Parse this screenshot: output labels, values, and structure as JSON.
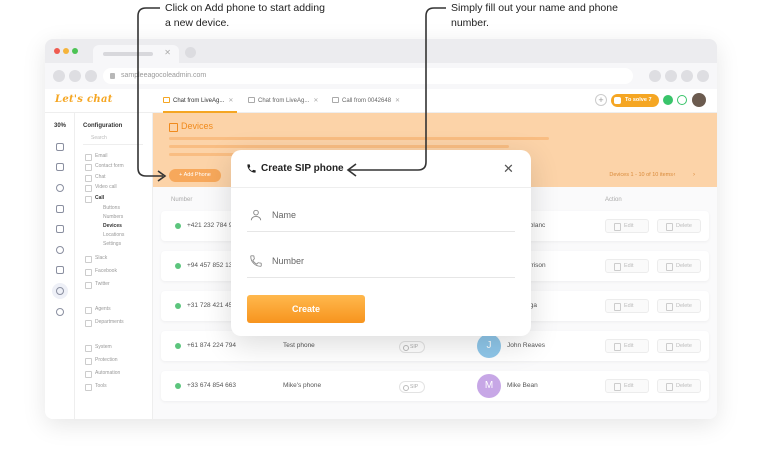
{
  "callouts": {
    "left": "Click on Add phone to start adding a new device.",
    "right": "Simply fill out your name and phone number."
  },
  "browser": {
    "url": "sampleeagocoleadmin.com"
  },
  "app": {
    "logo": "Let's chat",
    "tabs": [
      {
        "label": "Chat from LiveAg..."
      },
      {
        "label": "Chat from LiveAg..."
      },
      {
        "label": "Call from 0042648"
      }
    ],
    "solve_label": "To solve",
    "solve_count": "7",
    "left_pct": "30%"
  },
  "sidebar": {
    "title": "Configuration",
    "search_placeholder": "Search",
    "items": [
      {
        "label": "Email"
      },
      {
        "label": "Contact form"
      },
      {
        "label": "Chat"
      },
      {
        "label": "Video call"
      },
      {
        "label": "Call"
      },
      {
        "label": "Buttons"
      },
      {
        "label": "Numbers"
      },
      {
        "label": "Devices"
      },
      {
        "label": "Locations"
      },
      {
        "label": "Settings"
      },
      {
        "label": "Slack"
      },
      {
        "label": "Facebook"
      },
      {
        "label": "Twitter"
      },
      {
        "label": "Agents"
      },
      {
        "label": "Departments"
      },
      {
        "label": "System"
      },
      {
        "label": "Protection"
      },
      {
        "label": "Automation"
      },
      {
        "label": "Tools"
      }
    ]
  },
  "banner": {
    "title": "Devices",
    "add_phone_label": "+ Add Phone",
    "page_info": "Devices 1 - 10 of 10 items",
    "page_arrows": "‹ ›"
  },
  "table": {
    "headers": {
      "number": "Number",
      "action": "Action"
    },
    "edit_label": "Edit",
    "delete_label": "Delete",
    "sip_label": "SIP",
    "rows": [
      {
        "number": "+421 232 784 90",
        "name": "",
        "user": "Lucy Leblanc",
        "initial": "",
        "color": "#f3b3c4"
      },
      {
        "number": "+94 457 852 13",
        "name": "",
        "user": "Ben Morrison",
        "initial": "",
        "color": "#a7c7f0"
      },
      {
        "number": "+31 728 421 458",
        "name": "",
        "user": "Leo Parga",
        "initial": "",
        "color": "#c8b5ee"
      },
      {
        "number": "+61 874 224 794",
        "name": "Test phone",
        "user": "John Reaves",
        "initial": "J",
        "color": "#8fc7ea"
      },
      {
        "number": "+33 674 854 663",
        "name": "Mike's phone",
        "user": "Mike Bean",
        "initial": "M",
        "color": "#c7a7e6"
      }
    ]
  },
  "modal": {
    "title": "Create SIP phone",
    "name_placeholder": "Name",
    "number_placeholder": "Number",
    "create_label": "Create"
  },
  "colors": {
    "accent": "#f7941e",
    "banner": "#fcd3a8",
    "online": "#5cc57d"
  }
}
